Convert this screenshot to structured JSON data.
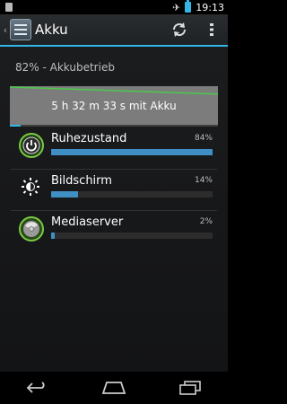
{
  "status_bar": {
    "time": "19:13",
    "icons": [
      "sim-card-icon",
      "airplane-mode-icon",
      "battery-icon"
    ]
  },
  "action_bar": {
    "title": "Akku",
    "icons": [
      "settings-app-icon",
      "refresh-icon",
      "overflow-menu-icon"
    ]
  },
  "summary": {
    "text": "82% - Akkubetrieb"
  },
  "graph": {
    "caption": "5 h 32 m 33 s mit Akku",
    "battery_start_percent": 100,
    "battery_end_percent": 82
  },
  "items": [
    {
      "label": "Ruhezustand",
      "percent_text": "84%",
      "fill_fraction": 1.0,
      "icon": "power-icon"
    },
    {
      "label": "Bildschirm",
      "percent_text": "14%",
      "fill_fraction": 0.167,
      "icon": "brightness-icon"
    },
    {
      "label": "Mediaserver",
      "percent_text": "2%",
      "fill_fraction": 0.024,
      "icon": "mediaserver-icon"
    }
  ],
  "navigation": {
    "icons": [
      "back-icon",
      "home-icon",
      "recent-apps-icon"
    ]
  },
  "colors": {
    "accent": "#33b5e5",
    "bar_fill": "#3f8fc4",
    "graph_line": "#4cc84c",
    "icon_green": "#7ac943"
  }
}
